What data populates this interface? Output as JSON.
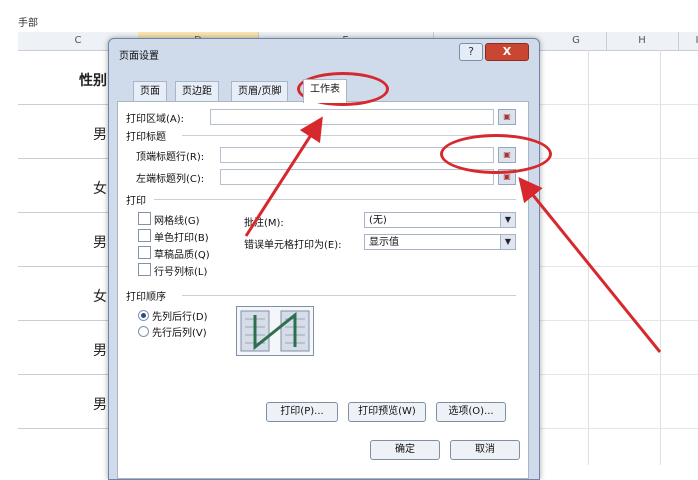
{
  "sheet": {
    "title": "手部",
    "columns": [
      "C",
      "D",
      "E",
      "G",
      "H",
      "I"
    ],
    "header_cell": "性别",
    "rows": [
      "男",
      "女",
      "男",
      "女",
      "男",
      "男"
    ]
  },
  "dialog": {
    "title": "页面设置",
    "help_label": "?",
    "close_label": "X",
    "tabs": [
      "页面",
      "页边距",
      "页眉/页脚",
      "工作表"
    ],
    "print_area_label": "打印区域(A):",
    "print_titles_section": "打印标题",
    "top_rows_label": "顶端标题行(R):",
    "left_columns_label": "左端标题列(C):",
    "print_section": "打印",
    "gridlines_label": "网格线(G)",
    "black_white_label": "单色打印(B)",
    "draft_label": "草稿品质(Q)",
    "row_col_headings_label": "行号列标(L)",
    "comments_label": "批注(M):",
    "comments_value": "(无)",
    "cell_errors_label": "错误单元格打印为(E):",
    "cell_errors_value": "显示值",
    "page_order_section": "打印顺序",
    "down_then_over_label": "先列后行(D)",
    "over_then_down_label": "先行后列(V)",
    "print_button": "打印(P)...",
    "preview_button": "打印预览(W)",
    "options_button": "选项(O)...",
    "ok_button": "确定",
    "cancel_button": "取消"
  },
  "colors": {
    "highlight": "#d7282e",
    "close": "#c84632",
    "dialog": "#cfdbea"
  }
}
